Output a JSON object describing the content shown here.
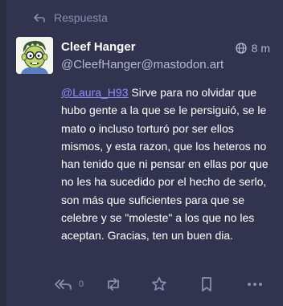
{
  "prepend": {
    "label": "Respuesta",
    "icon": "reply-icon"
  },
  "account": {
    "display_name": "Cleef Hanger",
    "handle": "@CleefHanger@mastodon.art",
    "avatar": "cartoon-avatar"
  },
  "meta": {
    "visibility_icon": "globe-icon",
    "timestamp": "8 m"
  },
  "content": {
    "mention": "@Laura_H93",
    "text": " Sirve para no olvidar que hubo gente a la que se le persiguió, se le mato o incluso torturó por ser ellos mismos, y esta razon, que los heteros no han tenido que ni pensar en ellas por que no les ha sucedido por el hecho de serlo, son más que suficientes para que se celebre y se \"moleste\" a los que no les aceptan. Gracias, ten un buen dia."
  },
  "actions": {
    "reply_count": "0",
    "icons": [
      "reply-all-icon",
      "boost-icon",
      "star-icon",
      "bookmark-icon",
      "more-icon"
    ]
  },
  "colors": {
    "background": "#32344f",
    "muted": "#8a8cb0",
    "link": "#8c8dff"
  }
}
